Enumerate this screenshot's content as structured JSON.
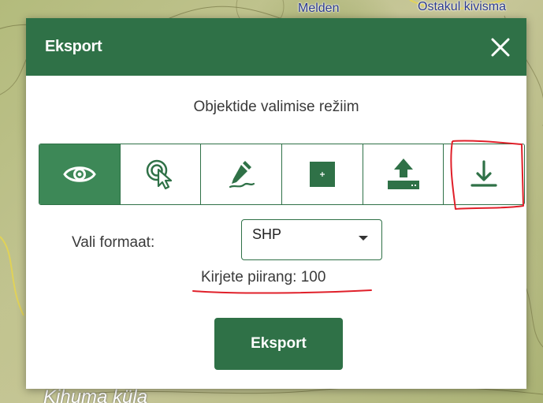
{
  "map": {
    "labels": [
      "Melden",
      "Ostakul kivisma",
      "Kihuma küla"
    ]
  },
  "dialog": {
    "title": "Eksport",
    "mode_title": "Objektide valimise režiim",
    "modes": [
      {
        "name": "eye-icon",
        "active": true
      },
      {
        "name": "pointer-select-icon",
        "active": false
      },
      {
        "name": "pencil-icon",
        "active": false
      },
      {
        "name": "add-square-icon",
        "active": false
      },
      {
        "name": "upload-icon",
        "active": false
      },
      {
        "name": "download-icon",
        "active": false
      }
    ],
    "format_label": "Vali formaat:",
    "format_value": "SHP",
    "record_limit": "Kirjete piirang: 100",
    "export_label": "Eksport"
  },
  "colors": {
    "brand": "#2f7147",
    "active_mode": "#3d8857",
    "annotation": "#e0202a"
  }
}
